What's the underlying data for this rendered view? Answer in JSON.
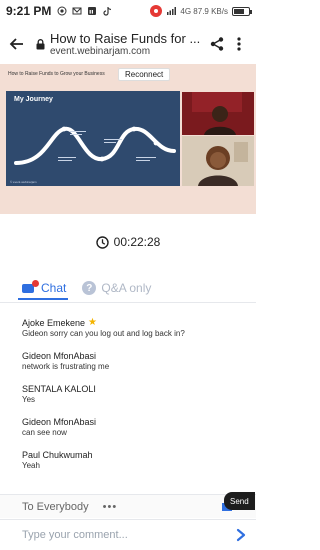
{
  "status_bar": {
    "time": "9:21 PM",
    "right_text": "4G 87.9 KB/s",
    "battery_level": 0.6
  },
  "browser": {
    "title": "How to Raise Funds for ...",
    "url": "event.webinarjam.com"
  },
  "stage": {
    "slide_caption": "How to Raise Funds to Grow your Business",
    "reconnect_label": "Reconnect",
    "slide_title": "My Journey",
    "slide_footer": "© event.webinarjam"
  },
  "timer": {
    "value": "00:22:28"
  },
  "tabs": [
    {
      "label": "Chat",
      "active": true
    },
    {
      "label": "Q&A only",
      "active": false
    }
  ],
  "messages": [
    {
      "name": "Ajoke Emekene",
      "text": "Gideon sorry can you log out and log back in?",
      "badge": "star-icon"
    },
    {
      "name": "Gideon MfonAbasi",
      "text": "network is frustrating me"
    },
    {
      "name": "SENTALA KALOLI",
      "text": "Yes"
    },
    {
      "name": "Gideon MfonAbasi",
      "text": "can see now"
    },
    {
      "name": "Paul Chukwumah",
      "text": "Yeah"
    }
  ],
  "composer": {
    "audience_label": "To Everybody",
    "more_label": "•••",
    "send_tooltip": "Send",
    "placeholder": "Type your comment..."
  },
  "colors": {
    "accent": "#2f6fe0",
    "stage_bg": "#f3ded4",
    "slide_bg": "#2f4a6e",
    "alert": "#e53935"
  }
}
